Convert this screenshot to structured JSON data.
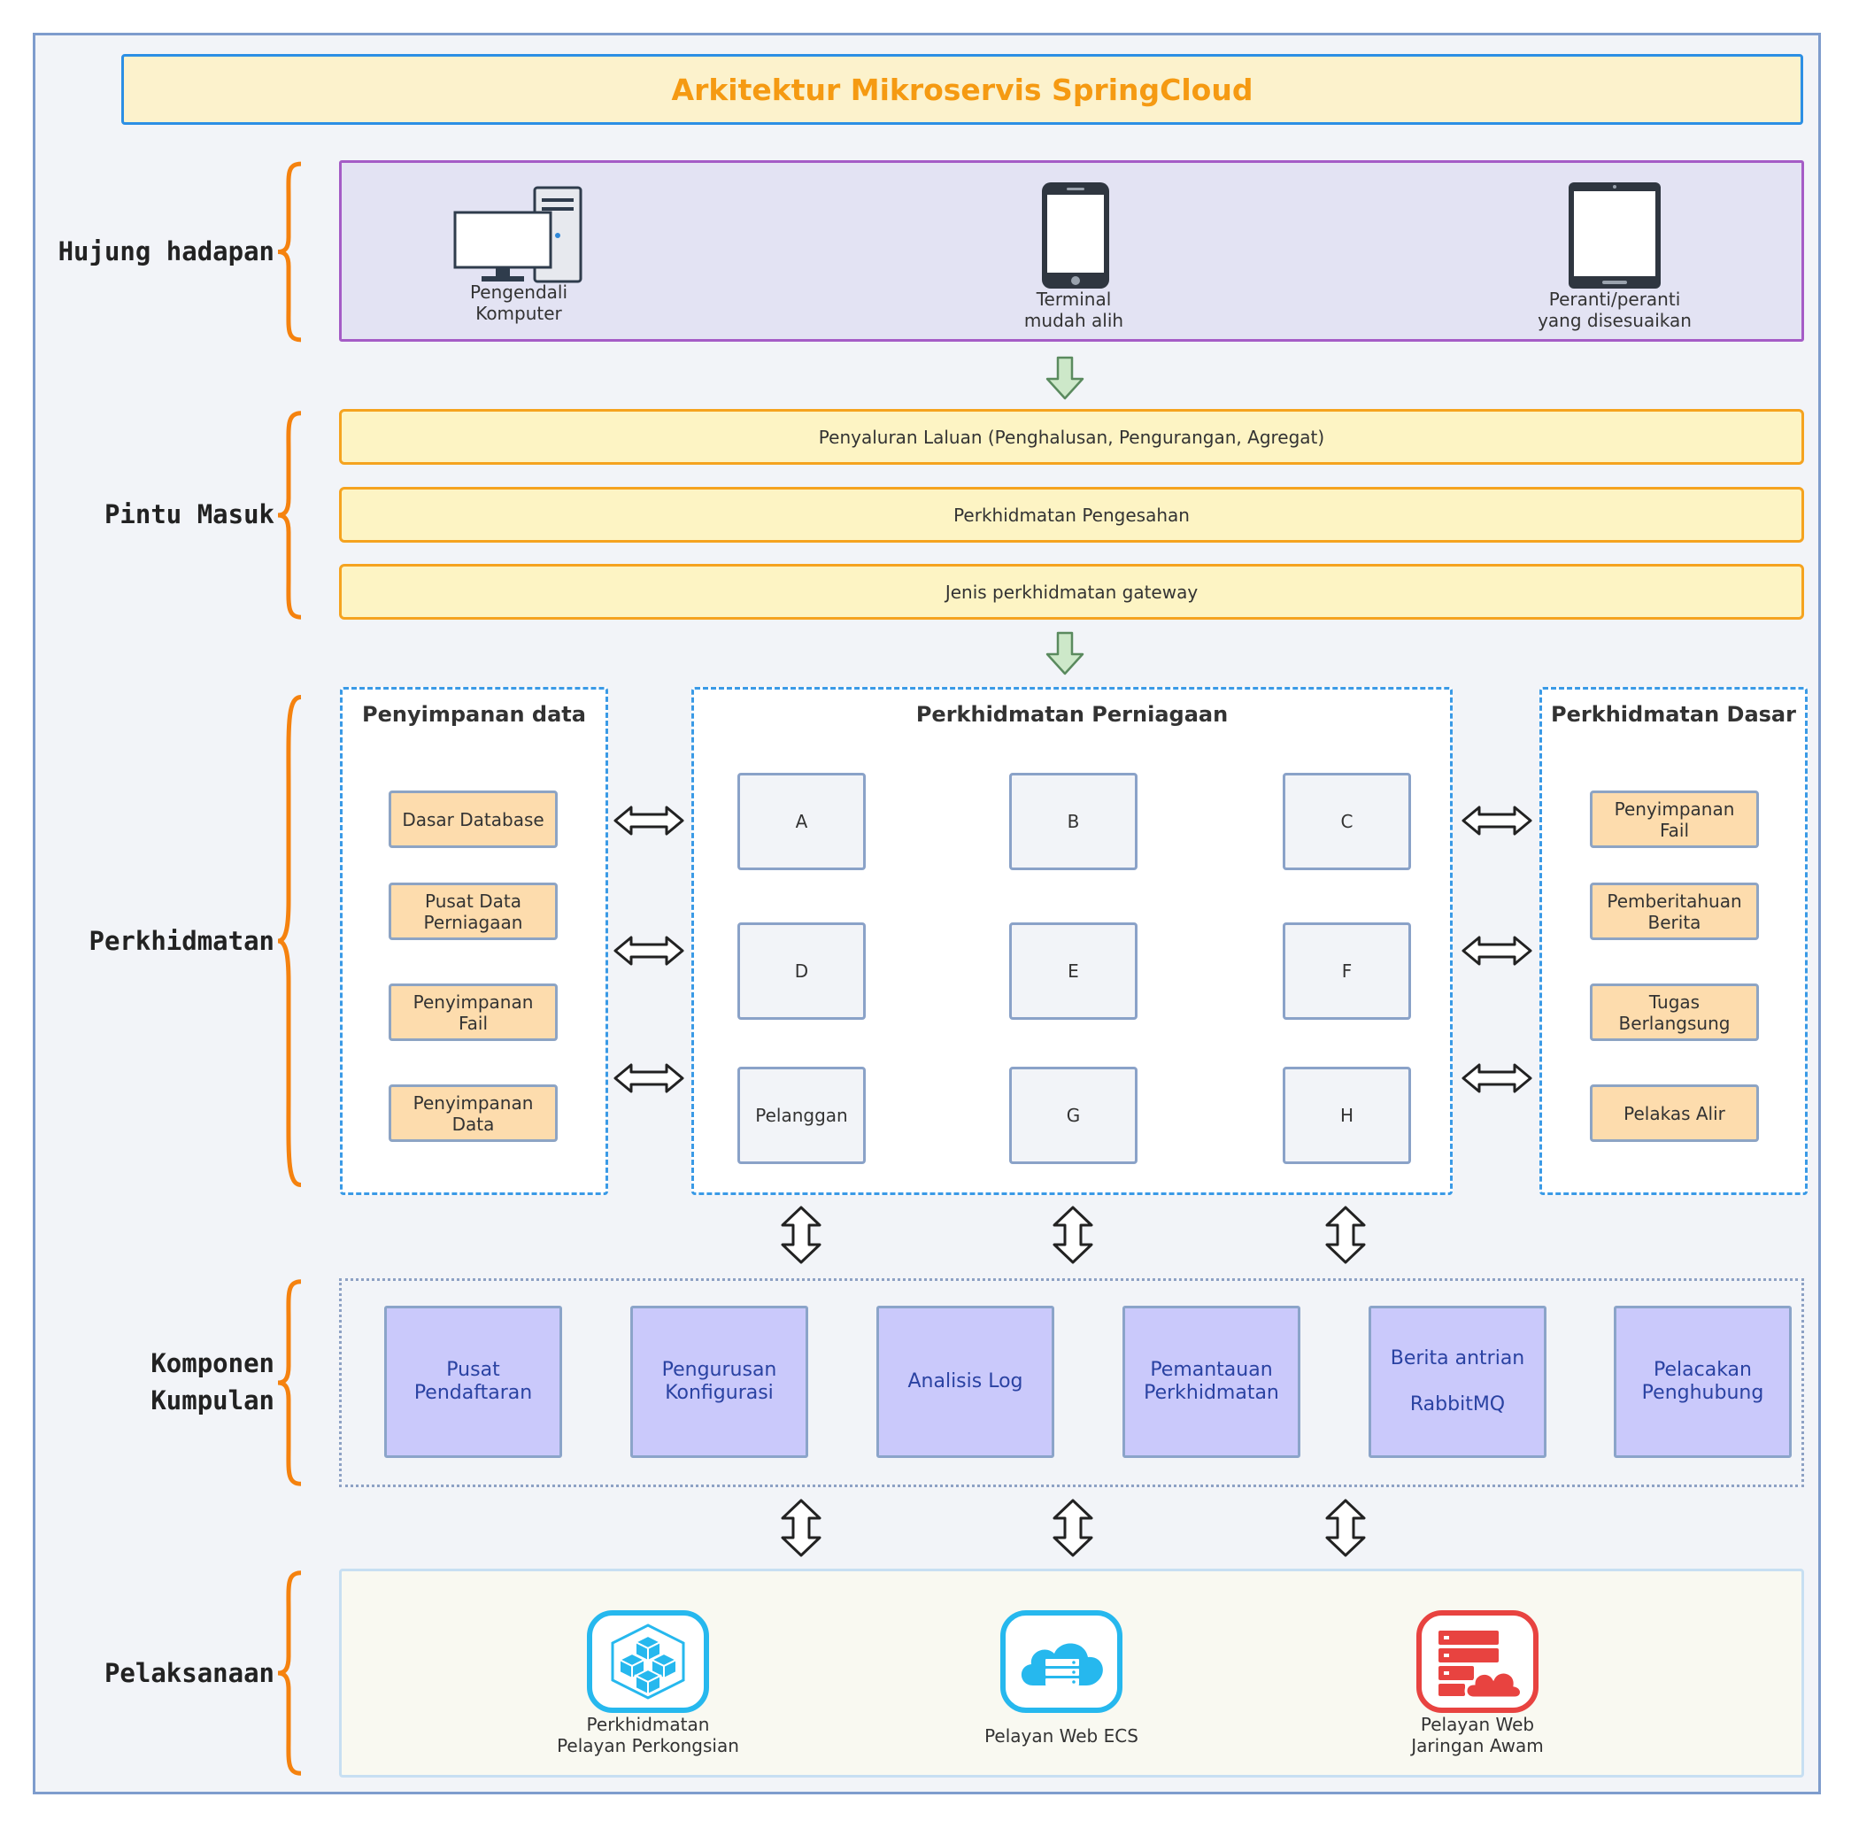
{
  "title": "Arkitektur Mikroservis SpringCloud",
  "layers": {
    "frontend": "Hujung hadapan",
    "gateway": "Pintu Masuk",
    "services": "Perkhidmatan",
    "cluster": [
      "Komponen",
      "Kumpulan"
    ],
    "implementation": "Pelaksanaan"
  },
  "frontend": {
    "devices": [
      {
        "icon": "desktop-computer-icon",
        "lines": [
          "Pengendali",
          "Komputer"
        ]
      },
      {
        "icon": "mobile-phone-icon",
        "lines": [
          "Terminal",
          "mudah alih"
        ]
      },
      {
        "icon": "tablet-icon",
        "lines": [
          "Peranti/peranti",
          "yang disesuaikan"
        ]
      }
    ]
  },
  "gateway": {
    "bars": [
      "Penyaluran Laluan (Penghalusan, Pengurangan, Agregat)",
      "Perkhidmatan Pengesahan",
      "Jenis perkhidmatan gateway"
    ]
  },
  "services": {
    "storage": {
      "title": "Penyimpanan data",
      "items": [
        [
          "Dasar Database"
        ],
        [
          "Pusat Data",
          "Perniagaan"
        ],
        [
          "Penyimpanan",
          "Fail"
        ],
        [
          "Penyimpanan",
          "Data"
        ]
      ]
    },
    "business": {
      "title": "Perkhidmatan Perniagaan",
      "items": [
        "A",
        "B",
        "C",
        "D",
        "E",
        "F",
        "Pelanggan",
        "G",
        "H"
      ]
    },
    "basic": {
      "title": "Perkhidmatan Dasar",
      "items": [
        [
          "Penyimpanan",
          "Fail"
        ],
        [
          "Pemberitahuan",
          "Berita"
        ],
        [
          "Tugas",
          "Berlangsung"
        ],
        [
          "Pelakas Alir"
        ]
      ]
    }
  },
  "cluster": {
    "items": [
      [
        "Pusat",
        "Pendaftaran"
      ],
      [
        "Pengurusan",
        "Konfigurasi"
      ],
      [
        "Analisis Log"
      ],
      [
        "Pemantauan",
        "Perkhidmatan"
      ],
      [
        "Berita antrian",
        "",
        "RabbitMQ"
      ],
      [
        "Pelacakan",
        "Penghubung"
      ]
    ]
  },
  "implementation": {
    "items": [
      {
        "icon": "shared-server-cubes-icon",
        "lines": [
          "Perkhidmatan",
          "Pelayan Perkongsian"
        ]
      },
      {
        "icon": "cloud-server-icon",
        "lines": [
          "Pelayan Web ECS"
        ]
      },
      {
        "icon": "public-cloud-server-icon",
        "lines": [
          "Pelayan Web",
          "Jaringan Awam"
        ]
      }
    ]
  },
  "colors": {
    "title": "#f59a12",
    "brace": "#f5820f",
    "down_arrow_fill": "#cde8c9",
    "down_arrow_stroke": "#5a8a5e",
    "cluster_text": "#2a42a2",
    "icon_blue": "#26b8ee",
    "icon_red": "#e84340"
  }
}
